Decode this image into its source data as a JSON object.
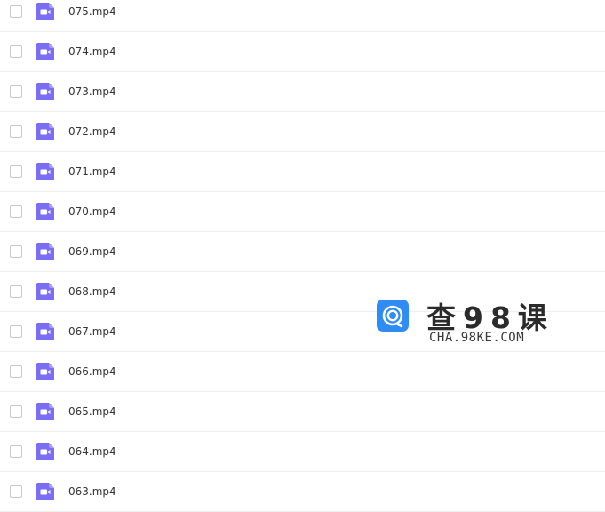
{
  "files": [
    {
      "name": "075.mp4",
      "icon": "video-file-icon"
    },
    {
      "name": "074.mp4",
      "icon": "video-file-icon"
    },
    {
      "name": "073.mp4",
      "icon": "video-file-icon"
    },
    {
      "name": "072.mp4",
      "icon": "video-file-icon"
    },
    {
      "name": "071.mp4",
      "icon": "video-file-icon"
    },
    {
      "name": "070.mp4",
      "icon": "video-file-icon"
    },
    {
      "name": "069.mp4",
      "icon": "video-file-icon"
    },
    {
      "name": "068.mp4",
      "icon": "video-file-icon"
    },
    {
      "name": "067.mp4",
      "icon": "video-file-icon"
    },
    {
      "name": "066.mp4",
      "icon": "video-file-icon"
    },
    {
      "name": "065.mp4",
      "icon": "video-file-icon"
    },
    {
      "name": "064.mp4",
      "icon": "video-file-icon"
    },
    {
      "name": "063.mp4",
      "icon": "video-file-icon"
    }
  ],
  "watermark": {
    "title": "查98课",
    "subtitle": "CHA.98KE.COM"
  },
  "colors": {
    "icon_purple": "#7a6ef6",
    "logo_blue": "#2f8cf5"
  }
}
